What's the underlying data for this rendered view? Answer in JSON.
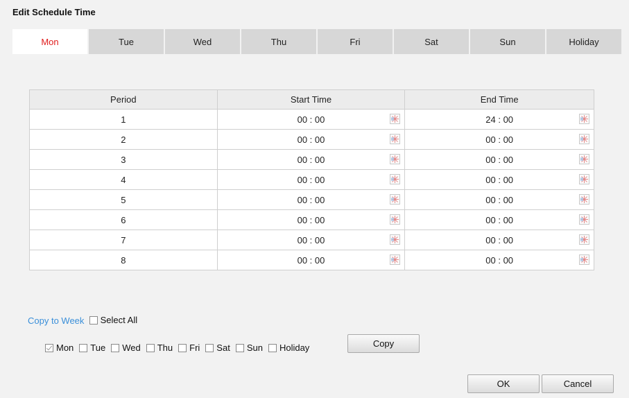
{
  "dialog": {
    "title": "Edit Schedule Time"
  },
  "tabs": [
    {
      "label": "Mon",
      "active": true
    },
    {
      "label": "Tue"
    },
    {
      "label": "Wed"
    },
    {
      "label": "Thu"
    },
    {
      "label": "Fri"
    },
    {
      "label": "Sat"
    },
    {
      "label": "Sun"
    },
    {
      "label": "Holiday"
    }
  ],
  "table": {
    "headers": [
      "Period",
      "Start Time",
      "End Time"
    ],
    "rows": [
      {
        "period": "1",
        "start": "00 : 00",
        "end": "24 : 00"
      },
      {
        "period": "2",
        "start": "00 : 00",
        "end": "00 : 00"
      },
      {
        "period": "3",
        "start": "00 : 00",
        "end": "00 : 00"
      },
      {
        "period": "4",
        "start": "00 : 00",
        "end": "00 : 00"
      },
      {
        "period": "5",
        "start": "00 : 00",
        "end": "00 : 00"
      },
      {
        "period": "6",
        "start": "00 : 00",
        "end": "00 : 00"
      },
      {
        "period": "7",
        "start": "00 : 00",
        "end": "00 : 00"
      },
      {
        "period": "8",
        "start": "00 : 00",
        "end": "00 : 00"
      }
    ]
  },
  "copy": {
    "label": "Copy to Week",
    "select_all_label": "Select All",
    "days": [
      {
        "label": "Mon",
        "checked": true
      },
      {
        "label": "Tue",
        "checked": false
      },
      {
        "label": "Wed",
        "checked": false
      },
      {
        "label": "Thu",
        "checked": false
      },
      {
        "label": "Fri",
        "checked": false
      },
      {
        "label": "Sat",
        "checked": false
      },
      {
        "label": "Sun",
        "checked": false
      },
      {
        "label": "Holiday",
        "checked": false
      }
    ],
    "button_label": "Copy"
  },
  "footer": {
    "ok_label": "OK",
    "cancel_label": "Cancel"
  },
  "colors": {
    "active_tab_text": "#e01c1c",
    "copy_label": "#3a8fd9",
    "tab_bg": "#d7d7d7"
  },
  "icons": {
    "time_picker": "clock-picker-icon"
  }
}
